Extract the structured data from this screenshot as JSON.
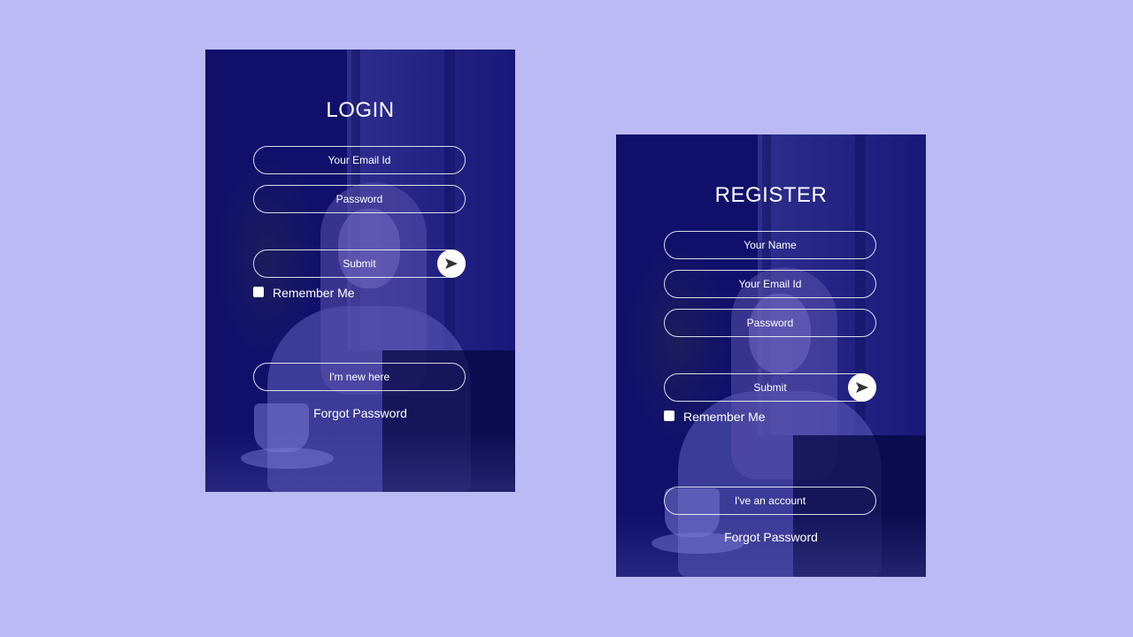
{
  "colors": {
    "background": "#bbbaf4",
    "card_tint": "#10106b",
    "text": "#ffffff"
  },
  "login": {
    "title": "LOGIN",
    "email_placeholder": "Your Email Id",
    "password_placeholder": "Password",
    "submit_label": "Submit",
    "submit_icon": "send-arrow-icon",
    "remember_label": "Remember Me",
    "new_here_label": "I'm new here",
    "forgot_label": "Forgot Password"
  },
  "register": {
    "title": "REGISTER",
    "name_placeholder": "Your Name",
    "email_placeholder": "Your Email Id",
    "password_placeholder": "Password",
    "submit_label": "Submit",
    "submit_icon": "send-arrow-icon",
    "remember_label": "Remember Me",
    "account_label": "I've an account",
    "forgot_label": "Forgot Password"
  }
}
